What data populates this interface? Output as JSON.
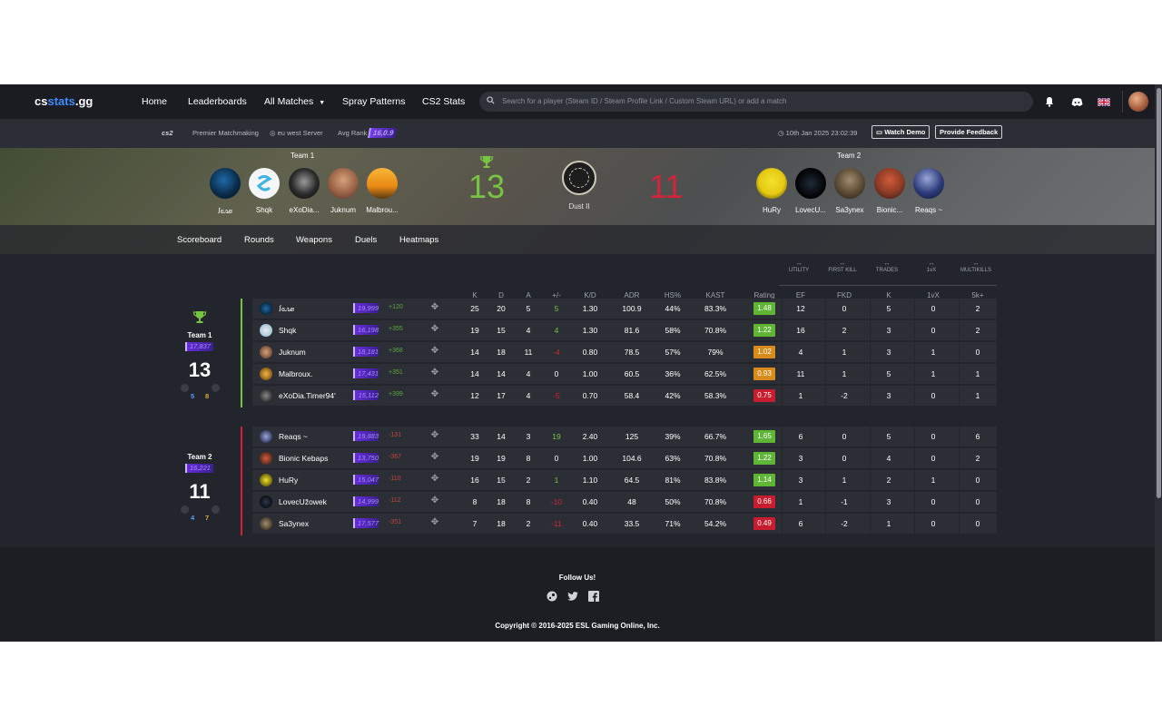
{
  "brand": {
    "logo_a": "cs",
    "logo_b": "stats",
    "logo_c": ".gg"
  },
  "nav": {
    "items": [
      "Home",
      "Leaderboards",
      "All Matches",
      "Spray Patterns",
      "CS2 Stats"
    ],
    "search_placeholder": "Search for a player (Steam ID / Steam Profile Link / Custom Steam URL) or add a match"
  },
  "info": {
    "game": "cs2",
    "mode": "Premier Matchmaking",
    "server": "eu west Server",
    "avg_rank_label": "Avg Rank",
    "avg_rank": "16,0.9",
    "date": "10th Jan 2025 23:02:39",
    "watch_demo": "Watch Demo",
    "feedback": "Provide Feedback"
  },
  "match": {
    "team1_name": "Team 1",
    "team2_name": "Team 2",
    "team1_score": "13",
    "team2_score": "11",
    "map": "Dust II",
    "team1_players": [
      "ꭍꮆꮑꮺ",
      "Shqk",
      "eXoDia...",
      "Juknum",
      "Malbrou..."
    ],
    "team2_players": [
      "HuRy",
      "LovecU...",
      "Sa3ynex",
      "Bionic...",
      "Reaqs ~"
    ]
  },
  "tabs": [
    "Scoreboard",
    "Rounds",
    "Weapons",
    "Duels",
    "Heatmaps"
  ],
  "columns": [
    "K",
    "D",
    "A",
    "+/-",
    "K/D",
    "ADR",
    "HS%",
    "KAST",
    "Rating"
  ],
  "extra_groups": [
    "UTILITY",
    "FIRST KILL",
    "TRADES",
    "1vX",
    "MULTIKILLS"
  ],
  "extra_columns": [
    "EF",
    "FKD",
    "K",
    "1vX",
    "5k+"
  ],
  "team1": {
    "label": "Team 1",
    "rank": "17,837",
    "score": "13",
    "ct": "5",
    "t": "8",
    "rows": [
      {
        "name": "ꭍꮆꮑꮺ",
        "rank": "19,999",
        "diff": "+120",
        "k": "25",
        "d": "20",
        "a": "5",
        "pm": "5",
        "kd": "1.30",
        "adr": "100.9",
        "hs": "44%",
        "kast": "83.3%",
        "rating": "1.48",
        "ef": "12",
        "fkd": "0",
        "tk": "5",
        "vx": "0",
        "mk": "2"
      },
      {
        "name": "Shqk",
        "rank": "16,198",
        "diff": "+355",
        "k": "19",
        "d": "15",
        "a": "4",
        "pm": "4",
        "kd": "1.30",
        "adr": "81.6",
        "hs": "58%",
        "kast": "70.8%",
        "rating": "1.22",
        "ef": "16",
        "fkd": "2",
        "tk": "3",
        "vx": "0",
        "mk": "2"
      },
      {
        "name": "Juknum",
        "rank": "18,181",
        "diff": "+368",
        "k": "14",
        "d": "18",
        "a": "11",
        "pm": "-4",
        "kd": "0.80",
        "adr": "78.5",
        "hs": "57%",
        "kast": "79%",
        "rating": "1.02",
        "ef": "4",
        "fkd": "1",
        "tk": "3",
        "vx": "1",
        "mk": "0"
      },
      {
        "name": "Malbroux.",
        "rank": "17,431",
        "diff": "+351",
        "k": "14",
        "d": "14",
        "a": "4",
        "pm": "0",
        "kd": "1.00",
        "adr": "60.5",
        "hs": "36%",
        "kast": "62.5%",
        "rating": "0.93",
        "ef": "11",
        "fkd": "1",
        "tk": "5",
        "vx": "1",
        "mk": "1"
      },
      {
        "name": "eXoDia.Timer94'",
        "rank": "15,112",
        "diff": "+399",
        "k": "12",
        "d": "17",
        "a": "4",
        "pm": "-5",
        "kd": "0.70",
        "adr": "58.4",
        "hs": "42%",
        "kast": "58.3%",
        "rating": "0.75",
        "ef": "1",
        "fkd": "-2",
        "tk": "3",
        "vx": "0",
        "mk": "1"
      }
    ]
  },
  "team2": {
    "label": "Team 2",
    "rank": "16,221",
    "score": "11",
    "ct": "4",
    "t": "7",
    "rows": [
      {
        "name": "Reaqs ~",
        "rank": "19,883",
        "diff": "-131",
        "k": "33",
        "d": "14",
        "a": "3",
        "pm": "19",
        "kd": "2.40",
        "adr": "125",
        "hs": "39%",
        "kast": "66.7%",
        "rating": "1.65",
        "ef": "6",
        "fkd": "0",
        "tk": "5",
        "vx": "0",
        "mk": "6"
      },
      {
        "name": "Bionic Kebaps",
        "rank": "13,750",
        "diff": "-367",
        "k": "19",
        "d": "19",
        "a": "8",
        "pm": "0",
        "kd": "1.00",
        "adr": "104.6",
        "hs": "63%",
        "kast": "70.8%",
        "rating": "1.22",
        "ef": "3",
        "fkd": "0",
        "tk": "4",
        "vx": "0",
        "mk": "2"
      },
      {
        "name": "HuRy",
        "rank": "15,047",
        "diff": "-110",
        "k": "16",
        "d": "15",
        "a": "2",
        "pm": "1",
        "kd": "1.10",
        "adr": "64.5",
        "hs": "81%",
        "kast": "83.8%",
        "rating": "1.14",
        "ef": "3",
        "fkd": "1",
        "tk": "2",
        "vx": "1",
        "mk": "0"
      },
      {
        "name": "LovecUžowek",
        "rank": "14,999",
        "diff": "-112",
        "k": "8",
        "d": "18",
        "a": "8",
        "pm": "-10",
        "kd": "0.40",
        "adr": "48",
        "hs": "50%",
        "kast": "70.8%",
        "rating": "0.66",
        "ef": "1",
        "fkd": "-1",
        "tk": "3",
        "vx": "0",
        "mk": "0"
      },
      {
        "name": "Sa3ynex",
        "rank": "17,577",
        "diff": "-351",
        "k": "7",
        "d": "18",
        "a": "2",
        "pm": "-11",
        "kd": "0.40",
        "adr": "33.5",
        "hs": "71%",
        "kast": "54.2%",
        "rating": "0.49",
        "ef": "6",
        "fkd": "-2",
        "tk": "1",
        "vx": "0",
        "mk": "0"
      }
    ]
  },
  "footer": {
    "follow": "Follow Us!",
    "copyright": "Copyright © 2016-2025 ESL Gaming Online, Inc."
  },
  "colors": {
    "win": "#76c442",
    "loss": "#d3243a",
    "rating_high": "#5fb536",
    "rating_mid": "#d88c1b",
    "rating_low": "#c81d2e"
  }
}
